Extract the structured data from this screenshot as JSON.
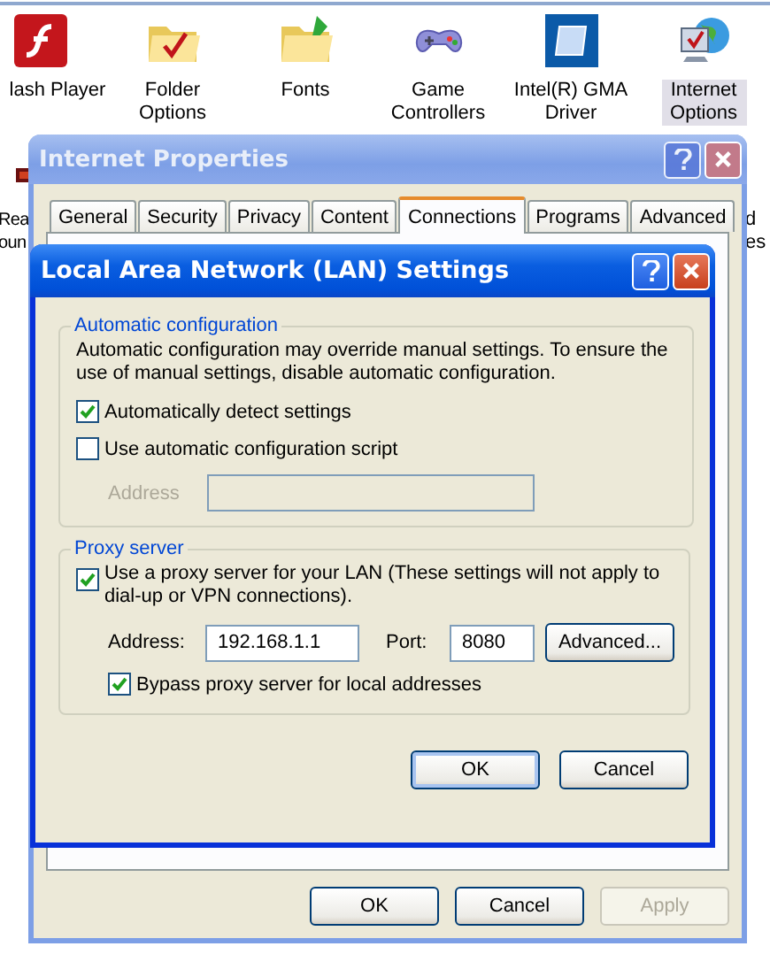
{
  "background": {
    "icons": [
      {
        "kind": "flash",
        "label": "lash Player",
        "selected": false
      },
      {
        "kind": "folder",
        "label": "Folder Options",
        "selected": false
      },
      {
        "kind": "fonts",
        "label": "Fonts",
        "selected": false
      },
      {
        "kind": "gamepad",
        "label": "Game Controllers",
        "selected": false
      },
      {
        "kind": "intel",
        "label": "Intel(R) GMA Driver",
        "selected": false
      },
      {
        "kind": "internet",
        "label": "Internet Options",
        "selected": true
      }
    ],
    "left_labels": [
      "Rea",
      "oun"
    ],
    "right_labels": [
      "d",
      "es"
    ]
  },
  "internet_properties": {
    "title": "Internet Properties",
    "tabs": [
      {
        "label": "General",
        "selected": false
      },
      {
        "label": "Security",
        "selected": false
      },
      {
        "label": "Privacy",
        "selected": false
      },
      {
        "label": "Content",
        "selected": false
      },
      {
        "label": "Connections",
        "selected": true
      },
      {
        "label": "Programs",
        "selected": false
      },
      {
        "label": "Advanced",
        "selected": false
      }
    ],
    "buttons": [
      {
        "label": "OK",
        "disabled": false
      },
      {
        "label": "Cancel",
        "disabled": false
      },
      {
        "label": "Apply",
        "disabled": true
      }
    ]
  },
  "lan_dialog": {
    "title": "Local Area Network (LAN) Settings",
    "automatic": {
      "title": "Automatic configuration",
      "description": "Automatic configuration may override manual settings.  To ensure the use of manual settings, disable automatic configuration.",
      "options": [
        {
          "label": "Automatically detect settings",
          "checked": true
        },
        {
          "label": "Use automatic configuration script",
          "checked": false
        }
      ],
      "address": {
        "label": "Address",
        "disabled": true
      }
    },
    "proxy": {
      "title": "Proxy server",
      "use_proxy": {
        "label": "Use a proxy server for your LAN (These settings will not apply to dial-up or VPN connections).",
        "checked": true
      },
      "address_label": "Address:",
      "address": "192.168.1.1",
      "port_label": "Port:",
      "port": "8080",
      "advanced": "Advanced...",
      "bypass": {
        "label": "Bypass proxy server for local addresses",
        "checked": true
      }
    },
    "buttons": [
      {
        "label": "OK",
        "default": true
      },
      {
        "label": "Cancel",
        "default": false
      }
    ]
  }
}
